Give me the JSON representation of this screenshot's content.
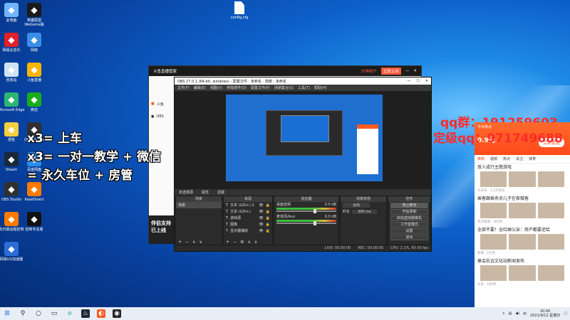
{
  "desktop_icons": [
    {
      "label": "此电脑",
      "icon": "computer-icon",
      "color": "#6fb5ff"
    },
    {
      "label": "英雄联盟WeGame版",
      "icon": "lol-icon",
      "color": "#1a1a1a"
    },
    {
      "label": "网易云音乐",
      "icon": "netease-music-icon",
      "color": "#e0202a"
    },
    {
      "label": "网络",
      "icon": "network-icon",
      "color": "#3a8ee6"
    },
    {
      "label": "回收站",
      "icon": "recycle-bin-icon",
      "color": "#cfe3f5"
    },
    {
      "label": "斗鱼直播",
      "icon": "douyu-icon",
      "color": "#f7b500"
    },
    {
      "label": "Microsoft Edge",
      "icon": "edge-icon",
      "color": "#2bb673"
    },
    {
      "label": "微信",
      "icon": "wechat-icon",
      "color": "#19ad19"
    },
    {
      "label": "便签",
      "icon": "note-icon",
      "color": "#f4d03f"
    },
    {
      "label": "OBS Studio",
      "icon": "obs-icon",
      "color": "#303030"
    },
    {
      "label": "Steam",
      "icon": "steam-icon",
      "color": "#1b2838"
    },
    {
      "label": "百度网盘",
      "icon": "baidu-pan-icon",
      "color": "#2a8cf0"
    },
    {
      "label": "OBS Studio",
      "icon": "obs-icon",
      "color": "#303030"
    },
    {
      "label": "KwaiDirect",
      "icon": "kwai-icon",
      "color": "#ff7a00"
    },
    {
      "label": "向日葵远程控制",
      "icon": "sunflower-icon",
      "color": "#ff7a00"
    },
    {
      "label": "剪映专业版",
      "icon": "capcut-icon",
      "color": "#111111"
    },
    {
      "label": "网易UU加速器",
      "icon": "uu-icon",
      "color": "#2b6ed6"
    }
  ],
  "desktop_file": {
    "label": "config.cfg"
  },
  "overlay": {
    "line1": "x3= 上车",
    "line2": "x3= 一对一教学 + 微信",
    "line3": "= 永久车位 + 房管",
    "qq1": "qq群：191259603",
    "qq2": "定级qq：971749688"
  },
  "douyu": {
    "title": "斗鱼直播管家",
    "user": "大神用户",
    "login": "立即上传",
    "side_items": [
      "斗鱼",
      "OBS"
    ],
    "banner": "伴侣支持 已上线"
  },
  "obs": {
    "title": "OBS 27.0.1 (64-bit, windows) - 配置文件：未命名 - 场景：未命名",
    "menu": [
      "文件(F)",
      "编辑(E)",
      "视图(V)",
      "停靠部件(D)",
      "配置文件(P)",
      "场景集合(S)",
      "工具(T)",
      "帮助(H)"
    ],
    "preview_toolbar": [
      "未选择源",
      "属性",
      "滤镜"
    ],
    "scenes_header": "场景",
    "scenes": [
      "场景"
    ],
    "sources_header": "来源",
    "sources": [
      "文本 (GDI+) 2",
      "文本 (GDI+)",
      "游戏源",
      "图像",
      "显示器捕获"
    ],
    "mixer_header": "混音器",
    "mixer": [
      {
        "name": "桌面音频",
        "db": "0.0 dB"
      },
      {
        "name": "麦克风/Aux",
        "db": "0.0 dB"
      }
    ],
    "mixer_level": 0.62,
    "transition_header": "场景转场",
    "transition": "淡出",
    "duration_label": "时长",
    "duration": "300 ms",
    "controls_header": "控件",
    "controls": [
      "停止推流",
      "开始录制",
      "启动虚拟摄像机",
      "工作室模式",
      "设置",
      "退出"
    ],
    "status": [
      "LIVE: 00:00:00",
      "REC: 00:00:00",
      "CPU: 2.1%, 60.00 fps"
    ]
  },
  "phone": {
    "header_left": "今日热点",
    "header_amount": "0.9元",
    "header_btn": "立即提现",
    "tabs": [
      "推荐",
      "视频",
      "热点",
      "关注",
      "体育"
    ],
    "news": [
      {
        "title": "双人成行主题游戏",
        "meta": "头条号 · 1.2万评论"
      },
      {
        "title": "乘客跟乘务员儿子在家做客",
        "meta": "热点新闻 · 300评"
      },
      {
        "title": "全部不要！全红婵父亲：房产都要还给",
        "meta": "新闻 · 2万评"
      },
      {
        "title": "章会抗议文化站新闻发布",
        "meta": "头条 · 180评"
      }
    ]
  },
  "taskbar": {
    "time": "20:00",
    "date": "2021/9/12 星期日"
  }
}
